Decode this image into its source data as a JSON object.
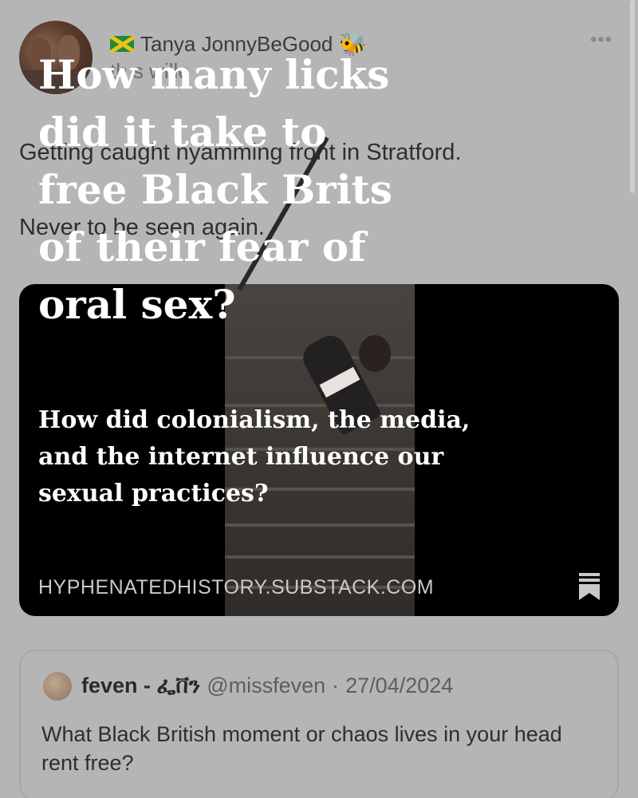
{
  "tweet": {
    "author_name": "Tanya JonnyBeGood",
    "author_icons": [
      "jamaica-flag-icon",
      "bee-icon"
    ],
    "replying_fragment": "th    s   wille",
    "text_line_1": "Getting caught nyamming front in Stratford.",
    "text_line_2": "Never to be seen again."
  },
  "overlay": {
    "headline": "How many licks did it take to free Black Brits of their fear of oral sex?",
    "subheadline": "How did colonialism, the media, and the internet influence our sexual practices?"
  },
  "link_card": {
    "domain": "HYPHENATEDHISTORY.SUBSTACK.COM",
    "bookmark_icon": "bookmark-icon"
  },
  "quote_tweet": {
    "name": "feven - ፌቨን",
    "handle": "@missfeven",
    "separator": "·",
    "date": "27/04/2024",
    "text": "What Black British moment or chaos lives in your head rent free?"
  },
  "colors": {
    "background": "#b5b5b5",
    "overlay_text": "#ffffff",
    "card_background": "#000000"
  }
}
